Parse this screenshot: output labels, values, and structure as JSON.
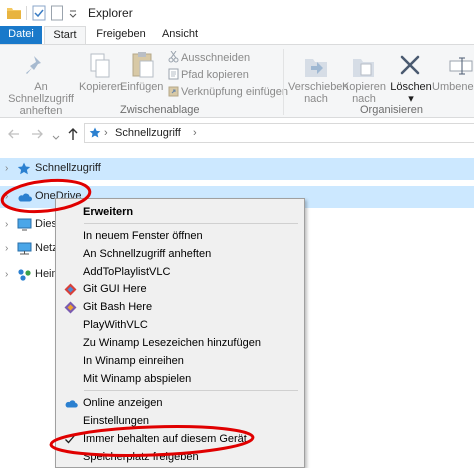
{
  "window": {
    "title": "Explorer"
  },
  "tabs": [
    {
      "label": "Datei"
    },
    {
      "label": "Start"
    },
    {
      "label": "Freigeben"
    },
    {
      "label": "Ansicht"
    }
  ],
  "ribbon": {
    "pin_line1": "An Schnellzugriff",
    "pin_line2": "anheften",
    "copy": "Kopieren",
    "paste": "Einfügen",
    "cut": "Ausschneiden",
    "copy_path": "Pfad kopieren",
    "paste_shortcut": "Verknüpfung einfügen",
    "clipboard_group": "Zwischenablage",
    "move_line1": "Verschieben",
    "move_line2": "nach",
    "copyto_line1": "Kopieren",
    "copyto_line2": "nach",
    "delete": "Löschen",
    "rename": "Umbenen",
    "organize_group": "Organisieren"
  },
  "address": {
    "crumb": "Schnellzugriff"
  },
  "tree": [
    {
      "label": "Schnellzugriff"
    },
    {
      "label": "OneDrive"
    },
    {
      "label": "Dies"
    },
    {
      "label": "Netz"
    },
    {
      "label": "Heim"
    }
  ],
  "context_menu": [
    {
      "label": "Erweitern"
    },
    {
      "label": "In neuem Fenster öffnen"
    },
    {
      "label": "An Schnellzugriff anheften"
    },
    {
      "label": "AddToPlaylistVLC"
    },
    {
      "label": "Git GUI Here"
    },
    {
      "label": "Git Bash Here"
    },
    {
      "label": "PlayWithVLC"
    },
    {
      "label": "Zu Winamp Lesezeichen hinzufügen"
    },
    {
      "label": "In Winamp einreihen"
    },
    {
      "label": "Mit Winamp abspielen"
    },
    {
      "label": "Online anzeigen"
    },
    {
      "label": "Einstellungen"
    },
    {
      "label": "Immer behalten auf diesem Gerät"
    },
    {
      "label": "Speicherplatz freigeben"
    }
  ],
  "colors": {
    "accent": "#1979ca",
    "selection": "#cce8ff",
    "annotation": "#e00000"
  }
}
